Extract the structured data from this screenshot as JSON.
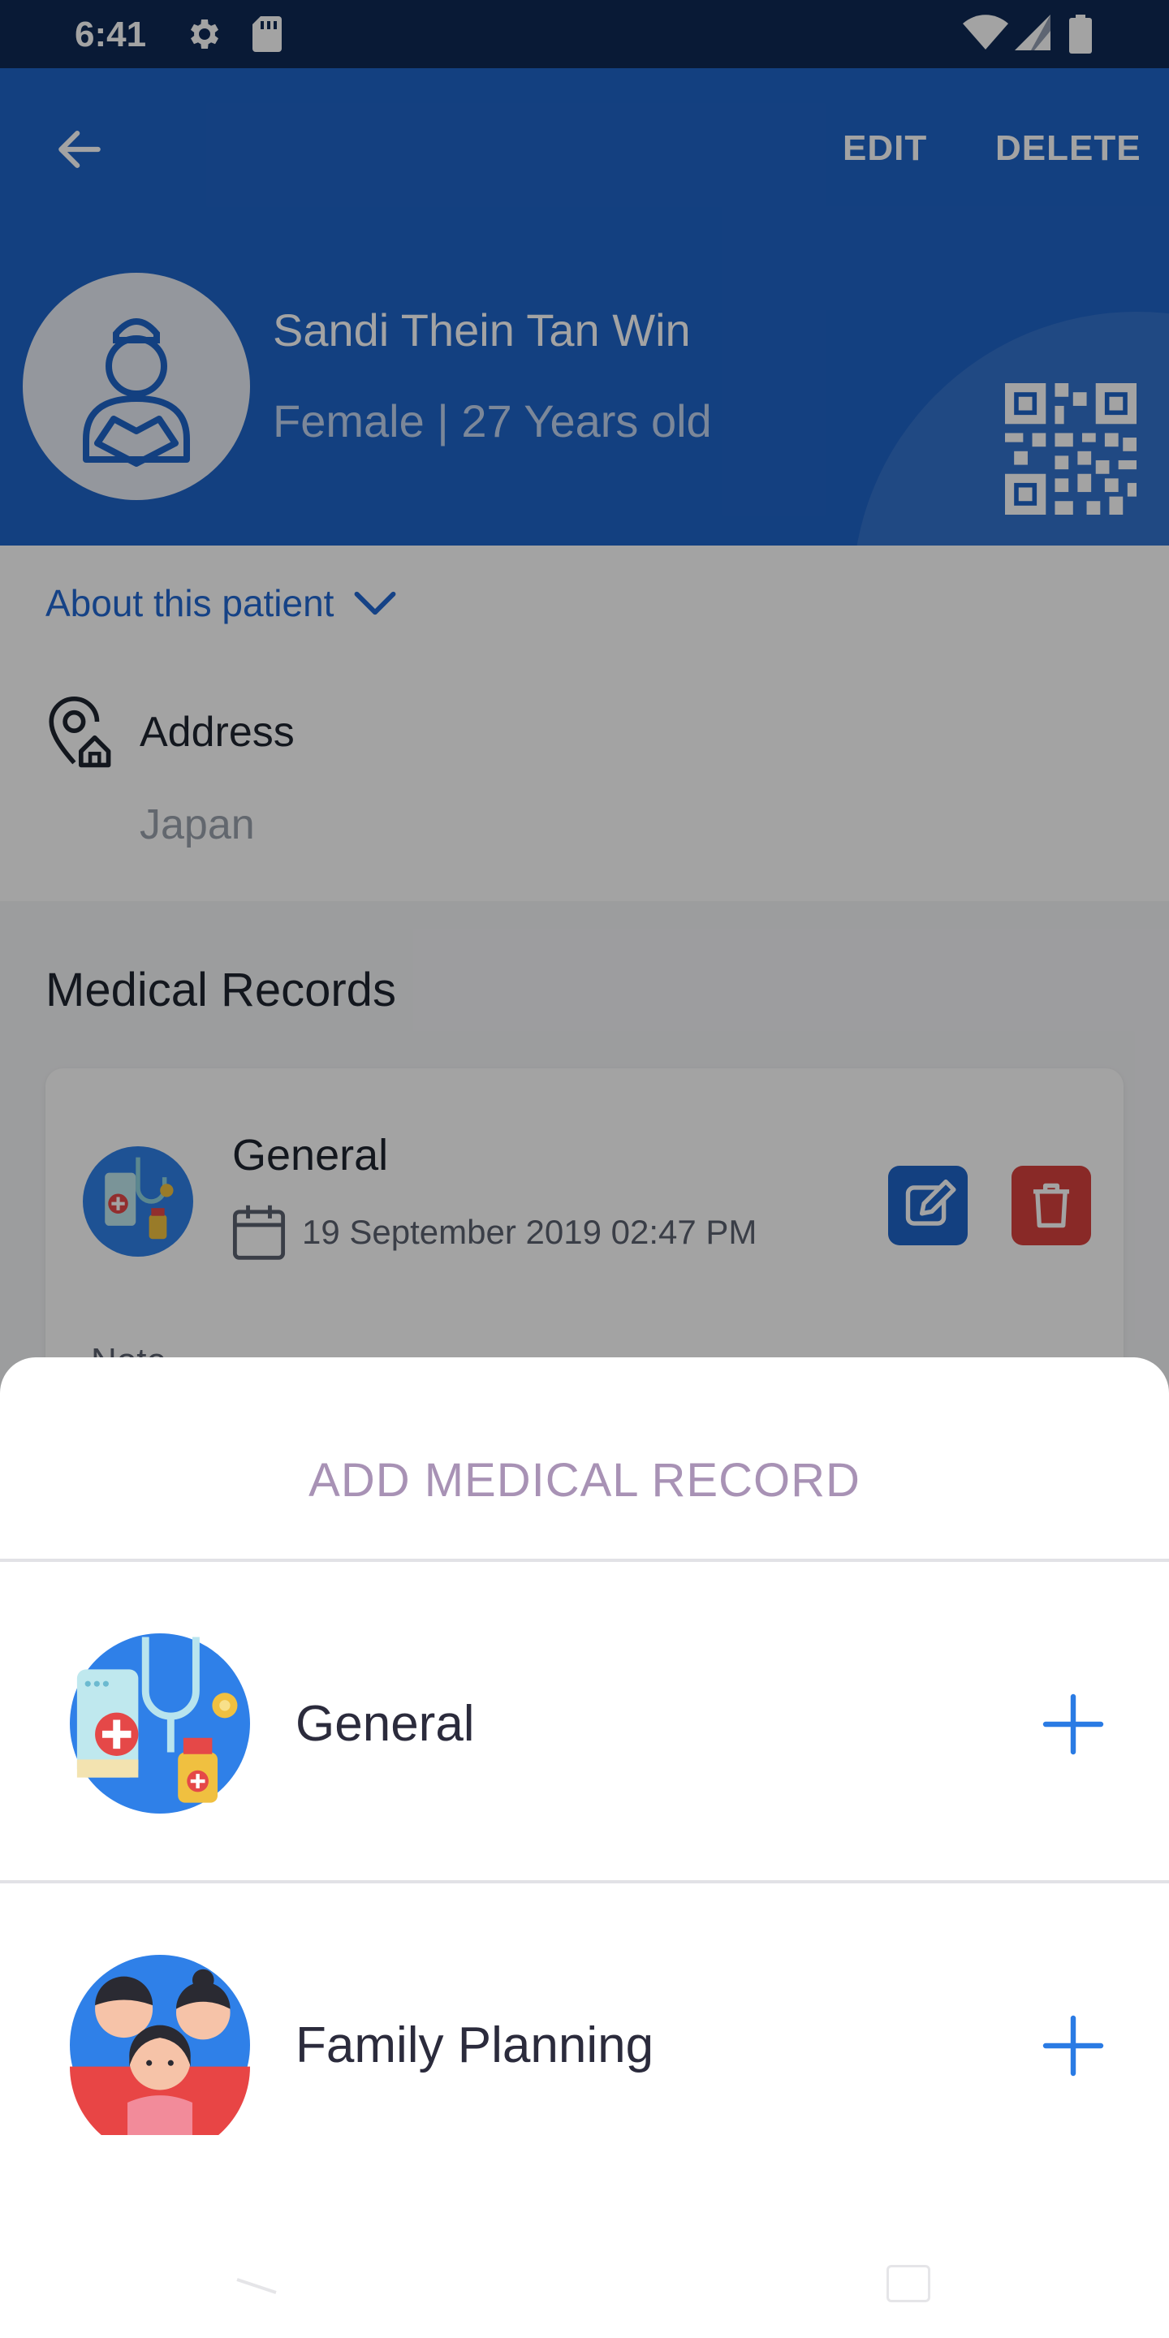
{
  "status_bar": {
    "time": "6:41",
    "left_icons": [
      "gear-icon",
      "sd-card-icon"
    ],
    "right_icons": [
      "wifi-icon",
      "cell-signal-icon",
      "battery-icon"
    ]
  },
  "header": {
    "back_icon": "arrow-left-icon",
    "edit_label": "EDIT",
    "delete_label": "DELETE",
    "patient_name": "Sandi Thein Tan Win",
    "patient_info": "Female | 27 Years old",
    "qr_icon": "qr-code-icon",
    "background_color": "#1f64c8"
  },
  "about": {
    "toggle_label": "About this patient",
    "address_label": "Address",
    "address_value": "Japan"
  },
  "records": {
    "title": "Medical Records",
    "card": {
      "title": "General",
      "date": "19 September 2019 02:47 PM",
      "note_label": "Note"
    }
  },
  "sheet": {
    "title": "ADD MEDICAL RECORD",
    "options": [
      {
        "label": "General",
        "icon": "medical-kit-icon"
      },
      {
        "label": "Family Planning",
        "icon": "family-icon"
      }
    ],
    "add_color": "#2a7be4"
  }
}
